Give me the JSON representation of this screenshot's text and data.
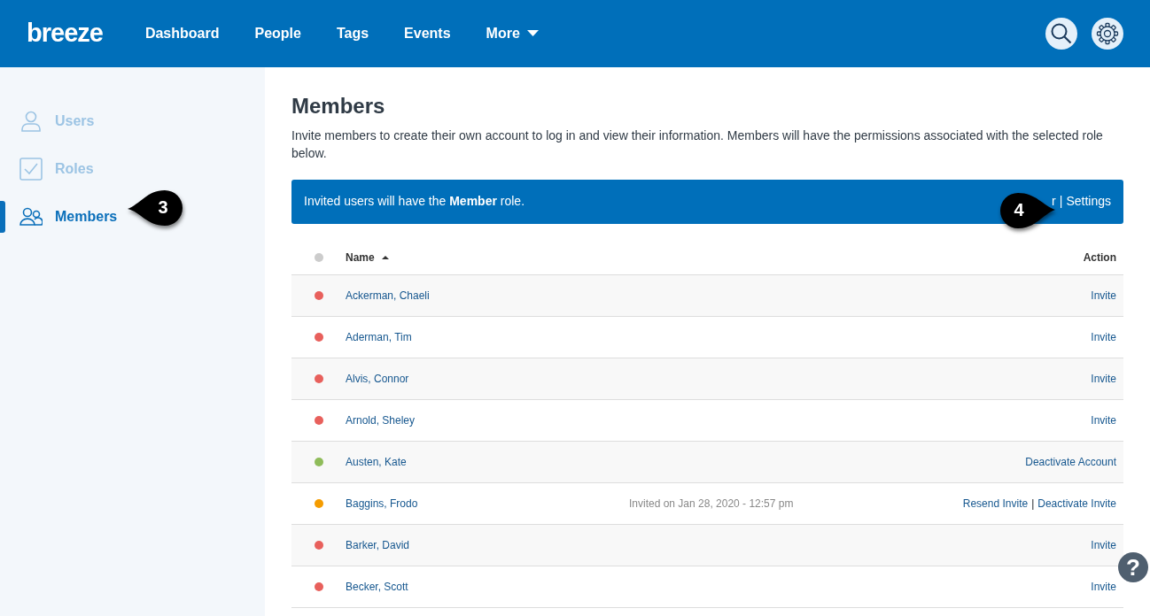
{
  "navbar": {
    "logo": "breeze",
    "links": [
      {
        "label": "Dashboard",
        "dropdown": false
      },
      {
        "label": "People",
        "dropdown": false
      },
      {
        "label": "Tags",
        "dropdown": false
      },
      {
        "label": "Events",
        "dropdown": false
      },
      {
        "label": "More",
        "dropdown": true
      }
    ]
  },
  "sidebar": {
    "items": [
      {
        "label": "Users",
        "selected": false
      },
      {
        "label": "Roles",
        "selected": false
      },
      {
        "label": "Members",
        "selected": true
      }
    ]
  },
  "page": {
    "title": "Members",
    "description": "Invite members to create their own account to log in and view their information. Members will have the permissions associated with the selected role below."
  },
  "banner": {
    "text": "Invited users will have the **Member** role.",
    "links": [
      "r",
      "Settings"
    ],
    "separator": "|"
  },
  "table": {
    "columns": [
      "Name",
      "Action"
    ],
    "rows": [
      {
        "name": "Ackerman, Chaeli",
        "color": "#e8605c",
        "actions": [
          "Invite"
        ]
      },
      {
        "name": "Aderman, Tim",
        "color": "#e8605c",
        "actions": [
          "Invite"
        ]
      },
      {
        "name": "Alvis, Connor",
        "color": "#e8605c",
        "actions": [
          "Invite"
        ]
      },
      {
        "name": "Arnold, Sheley",
        "color": "#e8605c",
        "actions": [
          "Invite"
        ]
      },
      {
        "name": "Austen, Kate",
        "color": "#8fbc5a",
        "actions": [
          "Deactivate Account"
        ]
      },
      {
        "name": "Baggins, Frodo",
        "color": "#f59c00",
        "note": "Invited on Jan 28, 2020 - 12:57 pm",
        "actions": [
          "Resend Invite",
          "Deactivate Invite"
        ],
        "separator": "|"
      },
      {
        "name": "Barker, David",
        "color": "#e8605c",
        "actions": [
          "Invite"
        ]
      },
      {
        "name": "Becker, Scott",
        "color": "#e8605c",
        "actions": [
          "Invite"
        ]
      }
    ]
  },
  "callouts": [
    {
      "label": "3"
    },
    {
      "label": "4"
    }
  ],
  "help_button": {
    "label": "?"
  }
}
